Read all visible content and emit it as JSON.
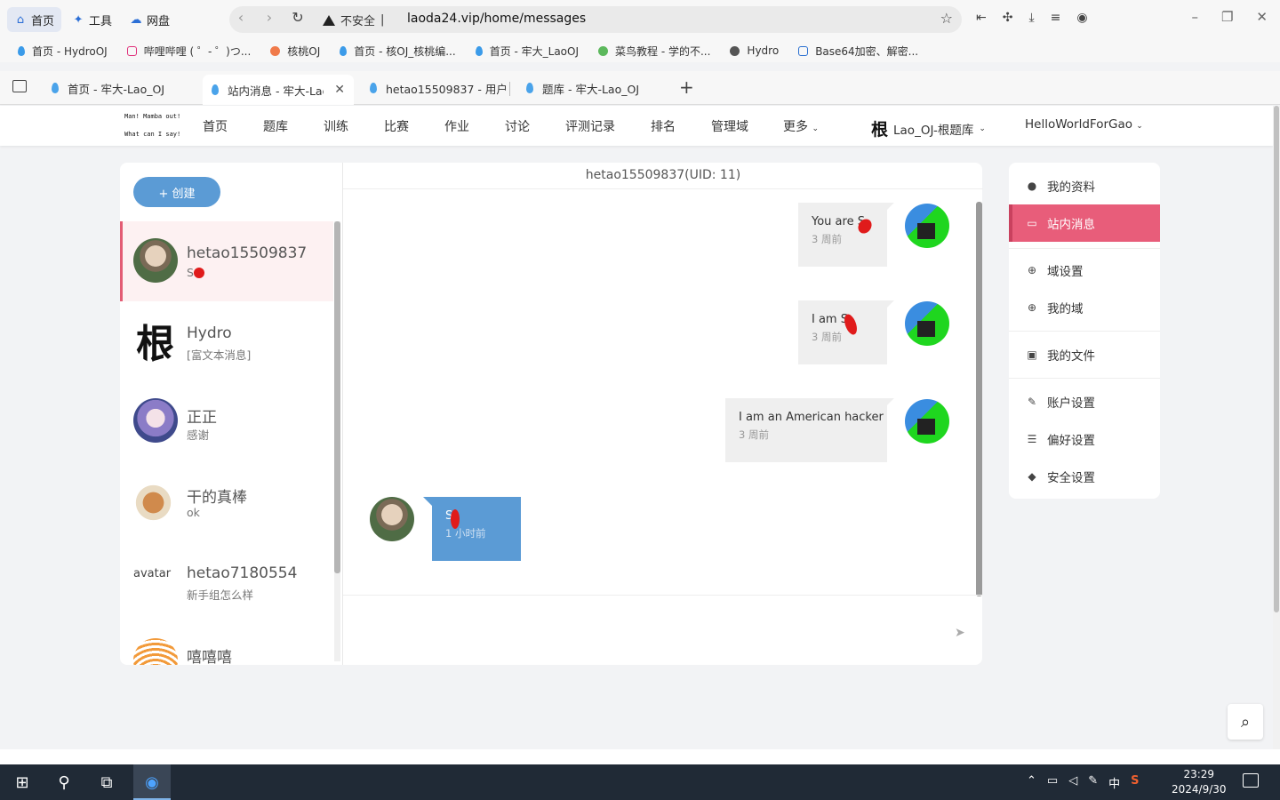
{
  "browser": {
    "pills": [
      {
        "icon": "home-icon",
        "label": "首页"
      },
      {
        "icon": "tools-icon",
        "label": "工具"
      },
      {
        "icon": "cloud-icon",
        "label": "网盘"
      }
    ],
    "insecure_label": "不安全",
    "url": "laoda24.vip/home/messages",
    "bookmarks": [
      {
        "label": "首页 - HydroOJ"
      },
      {
        "label": "哔哩哔哩 ( ゜- ゜)つ..."
      },
      {
        "label": "核桃OJ"
      },
      {
        "label": "首页 - 核OJ_核桃编..."
      },
      {
        "label": "首页 - 牢大_LaoOJ"
      },
      {
        "label": "菜鸟教程 - 学的不..."
      },
      {
        "label": "Hydro"
      },
      {
        "label": "Base64加密、解密..."
      }
    ],
    "tabs": [
      {
        "label": "首页 - 牢大-Lao_OJ"
      },
      {
        "label": "站内消息 - 牢大-Lao"
      },
      {
        "label": "hetao15509837 - 用户"
      },
      {
        "label": "题库 - 牢大-Lao_OJ"
      }
    ]
  },
  "site": {
    "logo_lines": [
      "Man! Mamba out!",
      "       ",
      "What can I say!"
    ],
    "nav": [
      "首页",
      "题库",
      "训练",
      "比赛",
      "作业",
      "讨论",
      "评测记录",
      "排名",
      "管理域"
    ],
    "more_label": "更多",
    "domain_glyph": "根",
    "domain_label": "Lao_OJ-根题库",
    "user_label": "HelloWorldForGao"
  },
  "conversations": {
    "create_label": "+ 创建",
    "items": [
      {
        "name": "hetao15509837",
        "preview": "S",
        "avatar": "photo-avatar"
      },
      {
        "name": "Hydro",
        "preview": "[富文本消息]",
        "avatar": "glyph-avatar",
        "glyph": "根"
      },
      {
        "name": "正正",
        "preview": "感谢",
        "avatar": "anime-avatar"
      },
      {
        "name": "干的真棒",
        "preview": "ok",
        "avatar": "cartoon-avatar"
      },
      {
        "name": "hetao7180554",
        "preview": "新手组怎么样",
        "avatar": "broken-avatar",
        "alt": "avatar"
      },
      {
        "name": "嘻嘻嘻",
        "preview": "",
        "avatar": "rings-avatar"
      }
    ]
  },
  "chat": {
    "title": "hetao15509837(UID: 11)",
    "messages": [
      {
        "text": "You are S",
        "time": "3 周前",
        "from": "other"
      },
      {
        "text": "I am S",
        "time": "3 周前",
        "from": "other"
      },
      {
        "text": "I am an American hacker",
        "time": "3 周前",
        "from": "other"
      },
      {
        "text": "S",
        "time": "1 小时前",
        "from": "me"
      }
    ]
  },
  "menu": {
    "items": [
      {
        "label": "我的资料",
        "icon": "user-icon"
      },
      {
        "label": "站内消息",
        "icon": "message-icon"
      },
      {
        "label": "域设置",
        "icon": "globe-icon"
      },
      {
        "label": "我的域",
        "icon": "globe-icon"
      },
      {
        "label": "我的文件",
        "icon": "image-file-icon"
      },
      {
        "label": "账户设置",
        "icon": "wrench-icon"
      },
      {
        "label": "偏好设置",
        "icon": "sliders-icon"
      },
      {
        "label": "安全设置",
        "icon": "shield-icon"
      }
    ],
    "active_index": 1
  },
  "taskbar": {
    "ime_label": "中",
    "time": "23:29",
    "date": "2024/9/30"
  },
  "colors": {
    "accent_blue": "#5b9bd5",
    "active_pink": "#e85d7a",
    "taskbar": "#202a36"
  }
}
